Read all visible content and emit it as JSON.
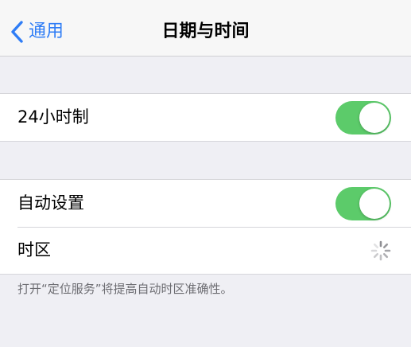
{
  "nav": {
    "back_label": "通用",
    "title": "日期与时间"
  },
  "settings": {
    "clock_24h": {
      "label": "24小时制",
      "enabled": true
    },
    "auto_set": {
      "label": "自动设置",
      "enabled": true
    },
    "timezone": {
      "label": "时区",
      "status": "loading"
    }
  },
  "footer": {
    "note": "打开“定位服务”将提高自动时区准确性。"
  },
  "colors": {
    "accent": "#2f7df6",
    "toggle_on": "#5ccb6a",
    "background": "#efeff4",
    "secondary_text": "#6d6d72"
  },
  "icons": {
    "back": "chevron-left-icon",
    "loading": "spinner-icon"
  }
}
